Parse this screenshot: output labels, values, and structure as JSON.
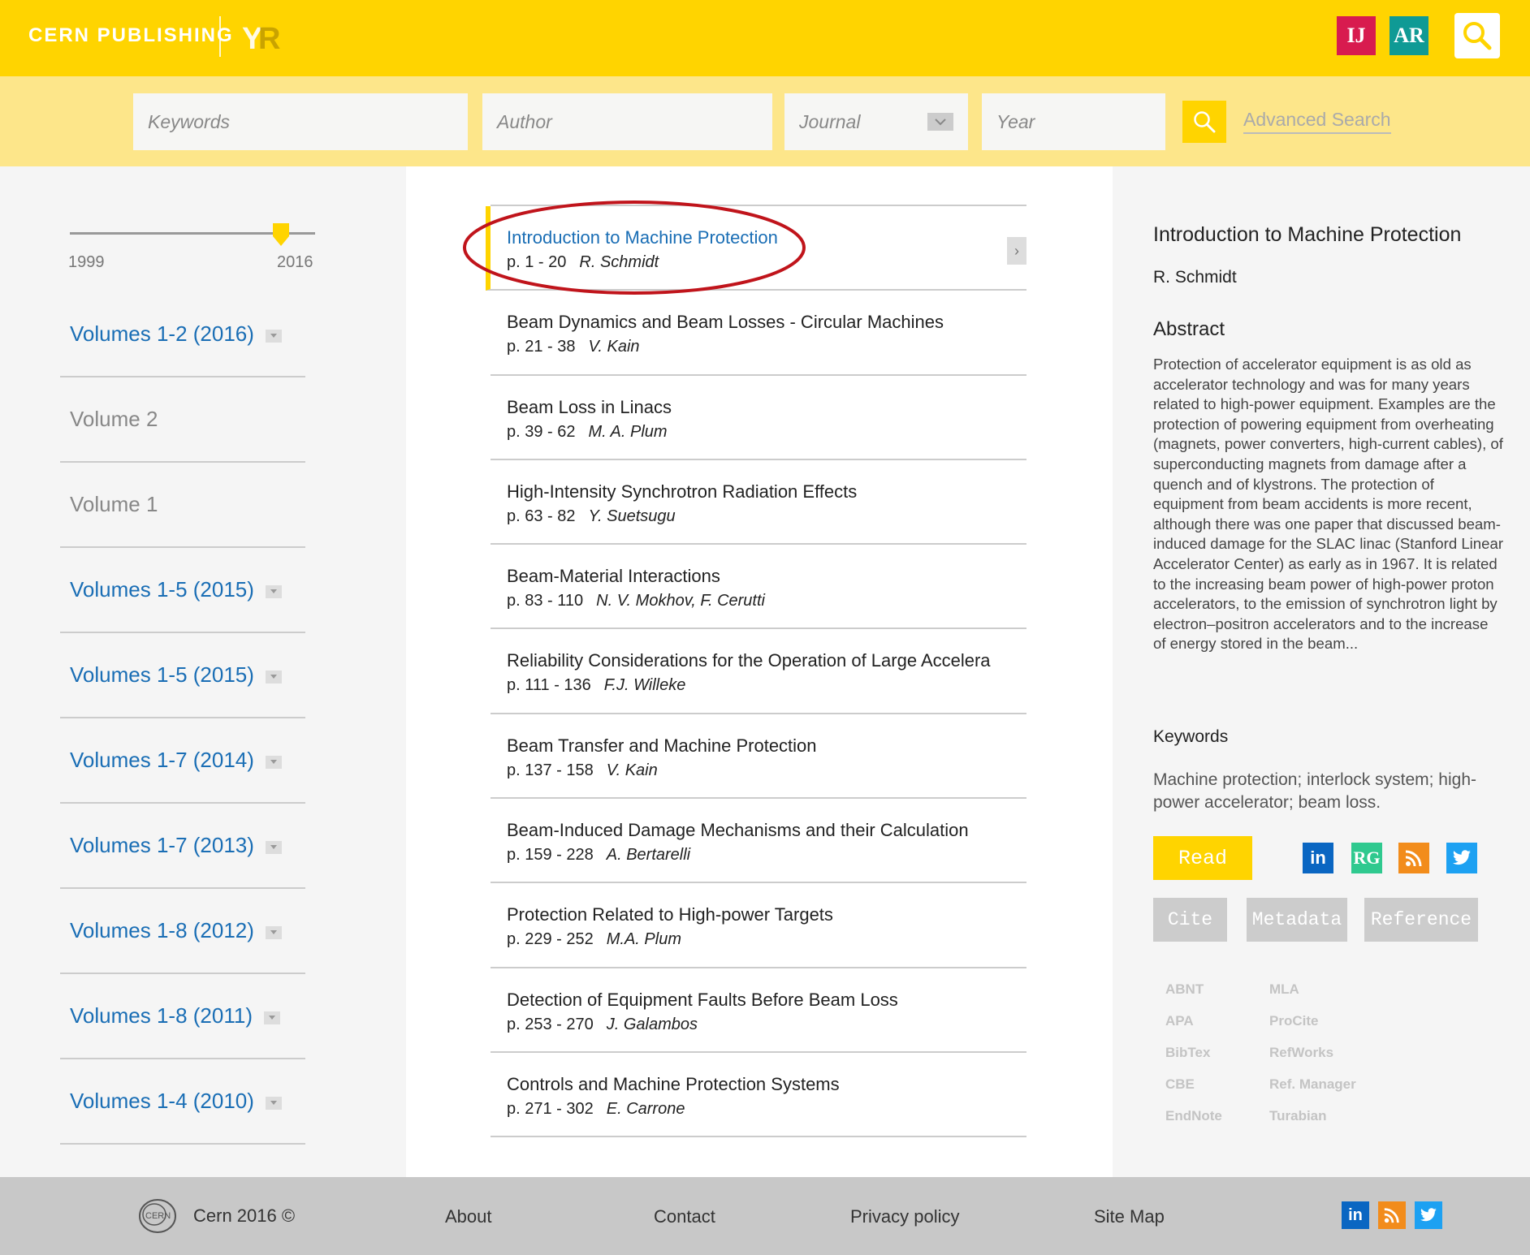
{
  "header": {
    "brand": "CERN PUBLISHING",
    "logo_text": "YR",
    "badge_ij": "IJ",
    "badge_ar": "AR",
    "search_icon": "search-icon"
  },
  "search": {
    "keywords_placeholder": "Keywords",
    "author_placeholder": "Author",
    "journal_placeholder": "Journal",
    "year_placeholder": "Year",
    "advanced_label": "Advanced Search"
  },
  "slider": {
    "min": "1999",
    "max": "2016",
    "value_fraction": 0.9
  },
  "volumes": [
    {
      "label": "Volumes 1-2 (2016)",
      "expandable": true
    },
    {
      "label": "Volume 2",
      "expandable": false
    },
    {
      "label": "Volume 1",
      "expandable": false
    },
    {
      "label": "Volumes 1-5 (2015)",
      "expandable": true
    },
    {
      "label": "Volumes 1-5 (2015)",
      "expandable": true
    },
    {
      "label": "Volumes 1-7 (2014)",
      "expandable": true
    },
    {
      "label": "Volumes 1-7 (2013)",
      "expandable": true
    },
    {
      "label": "Volumes 1-8 (2012)",
      "expandable": true
    },
    {
      "label": "Volumes 1-8 (2011)",
      "expandable": true
    },
    {
      "label": "Volumes 1-4 (2010)",
      "expandable": true
    }
  ],
  "articles": [
    {
      "title": "Introduction to Machine Protection",
      "pages": "p. 1 - 20",
      "author": "R. Schmidt",
      "active": true
    },
    {
      "title": "Beam Dynamics and Beam Losses - Circular Machines",
      "pages": "p. 21 - 38",
      "author": "V. Kain"
    },
    {
      "title": "Beam Loss in Linacs",
      "pages": "p. 39 - 62",
      "author": "M. A. Plum"
    },
    {
      "title": "High-Intensity Synchrotron Radiation Effects",
      "pages": "p. 63 - 82",
      "author": "Y. Suetsugu"
    },
    {
      "title": "Beam-Material Interactions",
      "pages": "p. 83 - 110",
      "author": "N. V. Mokhov, F. Cerutti"
    },
    {
      "title": "Reliability Considerations for the Operation of Large Accelera",
      "pages": "p. 111 - 136",
      "author": "F.J. Willeke"
    },
    {
      "title": "Beam Transfer and Machine Protection",
      "pages": "p. 137 - 158",
      "author": "V. Kain"
    },
    {
      "title": "Beam-Induced Damage Mechanisms and their Calculation",
      "pages": "p. 159 - 228",
      "author": "A. Bertarelli"
    },
    {
      "title": "Protection Related to High-power Targets",
      "pages": "p. 229 - 252",
      "author": "M.A. Plum"
    },
    {
      "title": "Detection of Equipment Faults Before Beam Loss",
      "pages": "p. 253 - 270",
      "author": "J. Galambos"
    },
    {
      "title": "Controls and Machine Protection Systems",
      "pages": "p. 271 - 302",
      "author": "E. Carrone"
    }
  ],
  "detail": {
    "title": "Introduction to Machine Protection",
    "author": "R. Schmidt",
    "abstract_heading": "Abstract",
    "abstract": "Protection of accelerator equipment is as old as accelerator technology and was for many years related to high-power equipment. Examples are the protection of powering equipment from overheating (magnets, power converters, high-current cables), of superconducting magnets from damage after a quench and of klystrons. The protection of equipment from beam accidents is more recent, although there was one paper that discussed beam-induced damage for the SLAC linac (Stanford Linear Accelerator Center) as early as in 1967. It is related to the increasing beam power of high-power proton accelerators, to the emission of synchrotron light by electron–positron accelerators and to the increase of energy stored in the beam...",
    "keywords_heading": "Keywords",
    "keywords": "Machine protection; interlock system; high-power accelerator; beam loss.",
    "read_label": "Read",
    "share_linkedin": "in",
    "share_rg": "RG",
    "cite_label": "Cite",
    "metadata_label": "Metadata",
    "reference_label": "Reference",
    "formats_a": [
      "ABNT",
      "APA",
      "BibTex",
      "CBE",
      "EndNote"
    ],
    "formats_b": [
      "MLA",
      "ProCite",
      "RefWorks",
      "Ref. Manager",
      "Turabian"
    ]
  },
  "footer": {
    "copyright": "Cern 2016 ©",
    "about": "About",
    "contact": "Contact",
    "privacy": "Privacy policy",
    "sitemap": "Site Map",
    "share_linkedin": "in"
  },
  "colors": {
    "brand_yellow": "#ffd400",
    "search_band": "#fde68a",
    "link_blue": "#1a6eb5",
    "annotation_red": "#c0141b"
  }
}
